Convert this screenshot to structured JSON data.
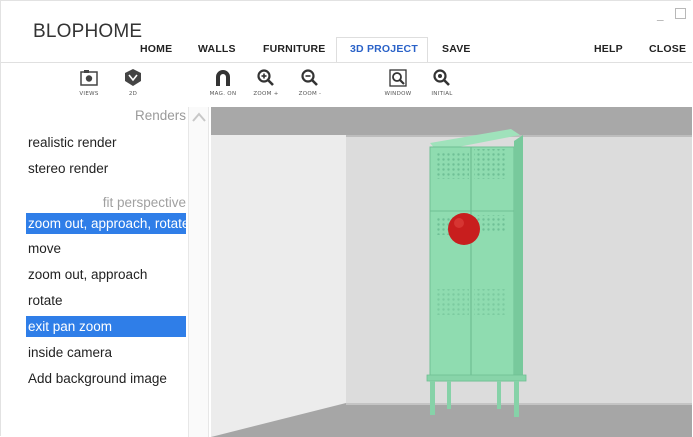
{
  "app": {
    "title": "BLOPHOME"
  },
  "nav": {
    "items": [
      {
        "label": "HOME"
      },
      {
        "label": "WALLS"
      },
      {
        "label": "FURNITURE"
      },
      {
        "label": "3D PROJECT",
        "active": true
      },
      {
        "label": "SAVE"
      },
      {
        "label": "HELP"
      },
      {
        "label": "CLOSE"
      }
    ]
  },
  "toolbar": {
    "buttons": [
      {
        "label": "VIEWS",
        "icon": "camera-icon"
      },
      {
        "label": "2D",
        "icon": "plan-2d-icon"
      },
      {
        "label": "MAG. ON",
        "icon": "magnet-icon"
      },
      {
        "label": "ZOOM +",
        "icon": "zoom-in-icon"
      },
      {
        "label": "ZOOM -",
        "icon": "zoom-out-icon"
      },
      {
        "label": "WINDOW",
        "icon": "zoom-window-icon"
      },
      {
        "label": "INITIAL",
        "icon": "zoom-initial-icon"
      }
    ]
  },
  "sidebar": {
    "header": "Renders",
    "subheader": "fit perspective",
    "render_items": [
      {
        "label": "realistic render",
        "selected": false
      },
      {
        "label": "stereo render",
        "selected": false
      }
    ],
    "nav_items": [
      {
        "label": "zoom out, approach, rotate",
        "selected": true
      },
      {
        "label": "move",
        "selected": false
      },
      {
        "label": "zoom out, approach",
        "selected": false
      },
      {
        "label": "rotate",
        "selected": false
      },
      {
        "label": "exit pan zoom",
        "selected": true
      },
      {
        "label": "inside camera",
        "selected": false
      },
      {
        "label": "Add background image",
        "selected": false
      }
    ]
  },
  "colors": {
    "accent": "#2a62c8",
    "selection": "#2f7ee8",
    "cabinet": "#8fdcb0",
    "marker": "#c81e1e"
  }
}
